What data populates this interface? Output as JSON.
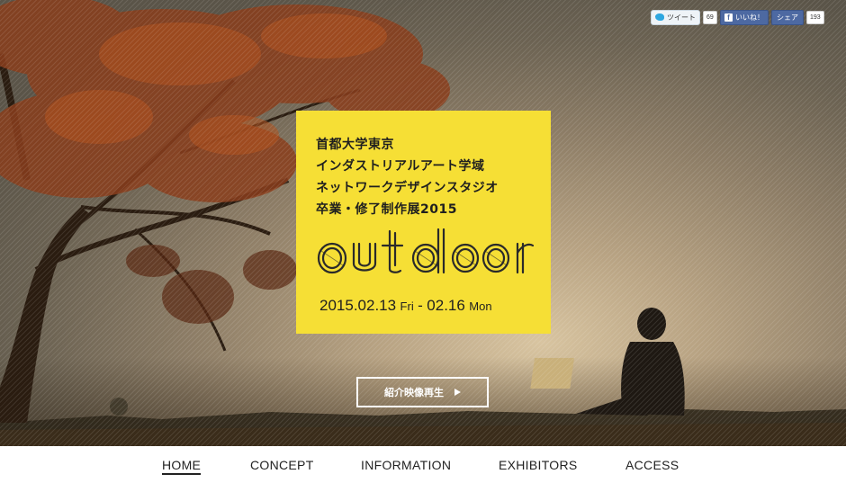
{
  "share": {
    "tweet_label": "ツイート",
    "tweet_count": "69",
    "like_label": "いいね！",
    "share_label": "シェア",
    "share_count": "193"
  },
  "event": {
    "line1": "首都大学東京",
    "line2": "インダストリアルアート学域",
    "line3": "ネットワークデザインスタジオ",
    "line4": "卒業・修了制作展2015",
    "logo_text": "outdoor",
    "date_start": "2015.02.13",
    "day_start": "Fri",
    "separator": "-",
    "date_end": "02.16",
    "day_end": "Mon"
  },
  "video_button": {
    "label": "紹介映像再生"
  },
  "nav": {
    "items": [
      {
        "label": "HOME"
      },
      {
        "label": "CONCEPT"
      },
      {
        "label": "INFORMATION"
      },
      {
        "label": "EXHIBITORS"
      },
      {
        "label": "ACCESS"
      }
    ]
  },
  "colors": {
    "accent": "#f6df35",
    "text": "#222222",
    "facebook": "#4d69a2",
    "twitter": "#2ea7e0"
  }
}
